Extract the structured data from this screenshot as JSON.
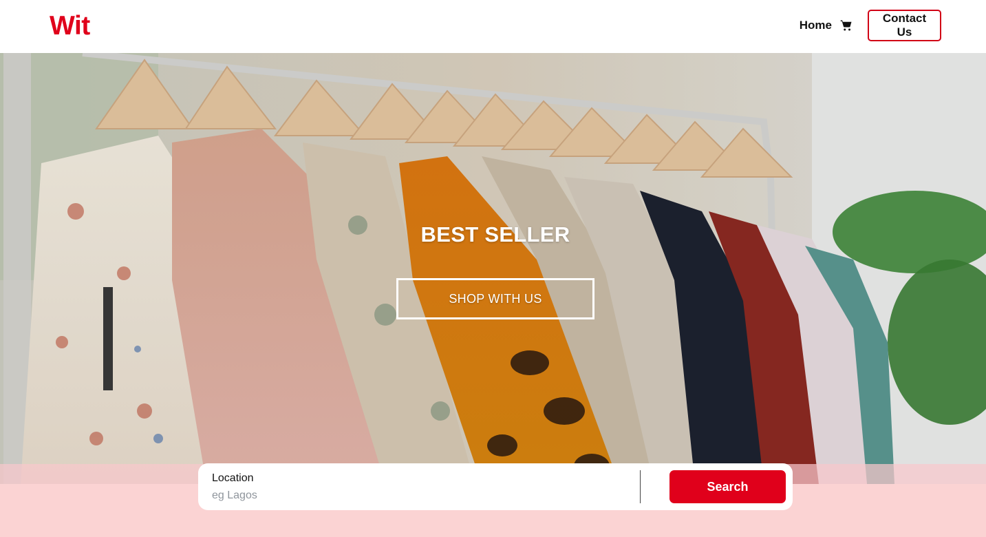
{
  "nav": {
    "logo": "Wit",
    "home_label": "Home",
    "cart_icon": "shopping-cart-icon",
    "contact_label": "Contact Us"
  },
  "hero": {
    "title": "BEST SELLER",
    "cta_label": "SHOP WITH US",
    "image_subject": "clothing-rack-photo"
  },
  "search": {
    "label": "Location",
    "placeholder": "eg Lagos",
    "value": "",
    "button_label": "Search"
  },
  "colors": {
    "brand_red": "#e0001b",
    "pink_band": "#fbd3d3",
    "white": "#ffffff"
  }
}
